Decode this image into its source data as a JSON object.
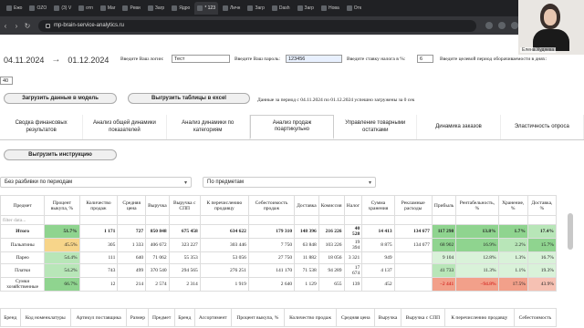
{
  "browser": {
    "tabs": [
      "Ежо",
      "OZO",
      "(3) V",
      "отп",
      "Mar",
      "Реви",
      "Загр",
      "Ядро",
      "* 123",
      "Личн",
      "Загр",
      "Dash",
      "Загр",
      "Нова",
      "Отк"
    ],
    "url": "mp-brain-service-analytics.ru"
  },
  "webcam": {
    "name": "Елена Худяева"
  },
  "period": {
    "start": "04.11.2024",
    "arrow": "→",
    "end": "01.12.2024"
  },
  "form": {
    "login_label": "Введите Ваш логин:",
    "login_value": "Тест",
    "password_label": "Введите Ваш пароль:",
    "password_value": "123456",
    "tax_label": "Введите ставку налога в %:",
    "tax_value": "6",
    "turnover_label": "Введите целевой период оборачиваемости в днях:",
    "turnover_value": "40"
  },
  "buttons": {
    "load": "Загрузить данные в модель",
    "export": "Выгрузить таблицы в excel",
    "instruction": "Выгрузить инструкцию"
  },
  "status": "Данные за период с 04.11.2024 по 01.12.2024 успешно загружены за 0 сек",
  "tabs": [
    "Сводка финансовых результатов",
    "Анализ общей динамики показателей",
    "Анализ динамики по категориям",
    "Анализ продаж поартикульно",
    "Управление товарными остатками",
    "Динамика заказов",
    "Эластичность опроса"
  ],
  "selects": {
    "breakdown": "Без разбивки по периодам",
    "grouping": "По предметам"
  },
  "table": {
    "headers": [
      "Предмет",
      "Процент выкупа, %",
      "Количество продаж",
      "Средняя цена",
      "Выручка",
      "Выручка с СПП",
      "К перечислению продавцу",
      "Себестоимость продаж",
      "Доставка",
      "Комиссия",
      "Налог",
      "Сумма хранения",
      "Рекламные расходы",
      "Прибыль",
      "Рентабельность, %",
      "Хранение, %",
      "Доставка, %"
    ],
    "filter_placeholder": "filter data...",
    "rows": [
      [
        "Итого",
        "51.7%",
        "1 171",
        "727",
        "850 848",
        "675 458",
        "634 622",
        "179 310",
        "148 396",
        "216 226",
        "40 528",
        "14 413",
        "134 677",
        "117 298",
        "13.8%",
        "1.7%",
        "17.4%"
      ],
      [
        "Пальатины",
        "45.5%",
        "305",
        "1 333",
        "406 672",
        "323 227",
        "303 446",
        "7 750",
        "63 848",
        "103 226",
        "19 394",
        "8 875",
        "134 677",
        "68 902",
        "16.9%",
        "2.2%",
        "15.7%"
      ],
      [
        "Парео",
        "54.4%",
        "111",
        "640",
        "71 062",
        "55 353",
        "53 056",
        "27 750",
        "11 882",
        "18 056",
        "3 321",
        "949",
        "",
        "9 104",
        "12.8%",
        "1.3%",
        "16.7%"
      ],
      [
        "Платки",
        "54.2%",
        "743",
        "499",
        "370 540",
        "294 565",
        "276 251",
        "141 170",
        "71 538",
        "94 289",
        "17 674",
        "4 137",
        "",
        "41 733",
        "11.3%",
        "1.1%",
        "19.3%"
      ],
      [
        "Сумки хозяйственные",
        "66.7%",
        "12",
        "214",
        "2 574",
        "2 314",
        "1 919",
        "2 640",
        "1 129",
        "655",
        "139",
        "452",
        "",
        "−2 441",
        "−94.8%",
        "17.5%",
        "43.9%"
      ]
    ]
  },
  "table2": {
    "headers": [
      "Бренд",
      "Код номенклатуры",
      "Артикул поставщика",
      "Размер",
      "Предмет",
      "Бренд",
      "Ассортимент",
      "Процент выкупа, %",
      "Количество продаж",
      "Средняя цена",
      "Выручка",
      "Выручка с СПП",
      "К перечислению продавцу",
      "Себестоимость"
    ]
  }
}
